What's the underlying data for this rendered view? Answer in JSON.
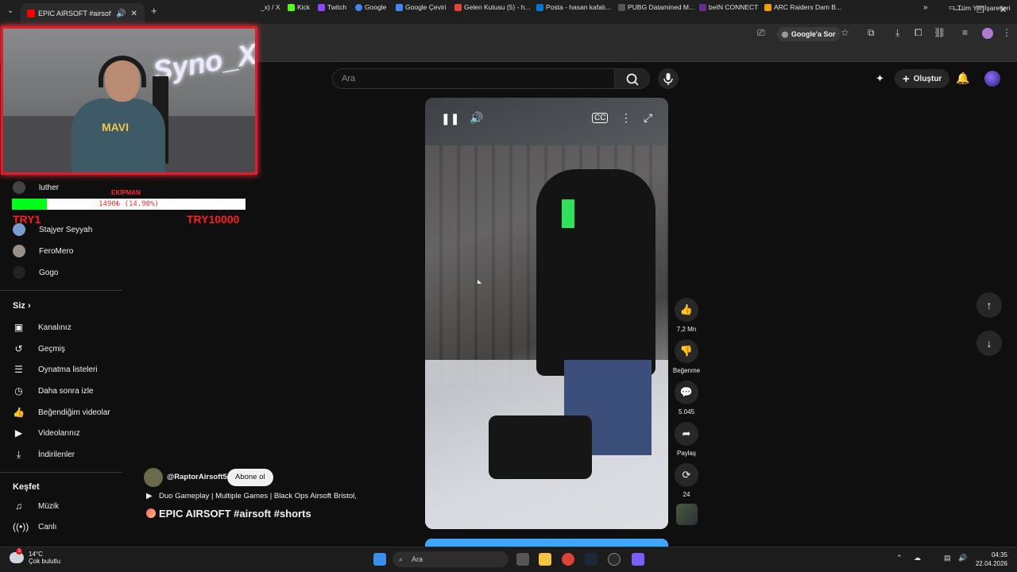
{
  "browser": {
    "tab_title": "EPIC AIRSOFT #airsoft #",
    "toolbar": {
      "google_sor": "Google'a Sor"
    },
    "bookmarks": [
      {
        "label": "_x) / X",
        "color": "#000000"
      },
      {
        "label": "Kick",
        "color": "#53fc18"
      },
      {
        "label": "Twitch",
        "color": "#9146ff"
      },
      {
        "label": "Google",
        "color": "#4285f4"
      },
      {
        "label": "Google Çeviri",
        "color": "#4285f4"
      },
      {
        "label": "Gelen Kutusu (5) - h...",
        "color": "#ea4335"
      },
      {
        "label": "Posta - hasan kafalı...",
        "color": "#0078d4"
      },
      {
        "label": "PUBG Datamined M...",
        "color": "#333333"
      },
      {
        "label": "beIN CONNECT",
        "color": "#6b2c91"
      },
      {
        "label": "ARC Raiders Dam B...",
        "color": "#f29f05"
      }
    ],
    "all_bookmarks": "Tüm Yer İşaretleri"
  },
  "header": {
    "search_placeholder": "Ara",
    "create_label": "Oluştur"
  },
  "overlay": {
    "webcam_text": "Syno_X",
    "shirt_text": "MAVI",
    "donation": {
      "label": "EKİPMAN",
      "progress_text": "1490₺ (14.90%)",
      "progress_fraction": 0.149,
      "min_label": "TRY1",
      "max_label": "TRY10000"
    }
  },
  "sidebar": {
    "subscriptions": [
      {
        "label": "luther",
        "color": "#444"
      },
      {
        "label": "Stajyer Seyyah",
        "color": "#7a9ccf"
      },
      {
        "label": "FeroMero",
        "color": "#9a8f88"
      },
      {
        "label": "Gogo",
        "color": "#222"
      }
    ],
    "you_section": "Siz",
    "you_items": [
      {
        "label": "Kanalınız",
        "icon": "channel-icon"
      },
      {
        "label": "Geçmiş",
        "icon": "history-icon"
      },
      {
        "label": "Oynatma listeleri",
        "icon": "playlist-icon"
      },
      {
        "label": "Daha sonra izle",
        "icon": "watch-later-icon"
      },
      {
        "label": "Beğendiğim videolar",
        "icon": "liked-icon"
      },
      {
        "label": "Videolarınız",
        "icon": "videos-icon"
      },
      {
        "label": "İndirilenler",
        "icon": "download-icon"
      }
    ],
    "explore_section": "Keşfet",
    "explore_items": [
      {
        "label": "Müzik",
        "icon": "music-icon"
      },
      {
        "label": "Canlı",
        "icon": "live-icon"
      }
    ]
  },
  "short": {
    "channel": "@RaptorAirsoft5",
    "subscribe_label": "Abone ol",
    "description": "Duo Gameplay | Multiple Games | Black Ops Airsoft Bristol,",
    "title": "EPIC AIRSOFT #airsoft #shorts",
    "likes": "7,2 Mn",
    "dislike_label": "Beğenme",
    "comments": "5.045",
    "share_label": "Paylaş",
    "remix_count": "24"
  },
  "taskbar": {
    "temperature": "14°C",
    "weather": "Çok bulutlu",
    "weather_badge": "3",
    "search_placeholder": "Ara",
    "time": "04:35",
    "date": "22.04.2026"
  }
}
